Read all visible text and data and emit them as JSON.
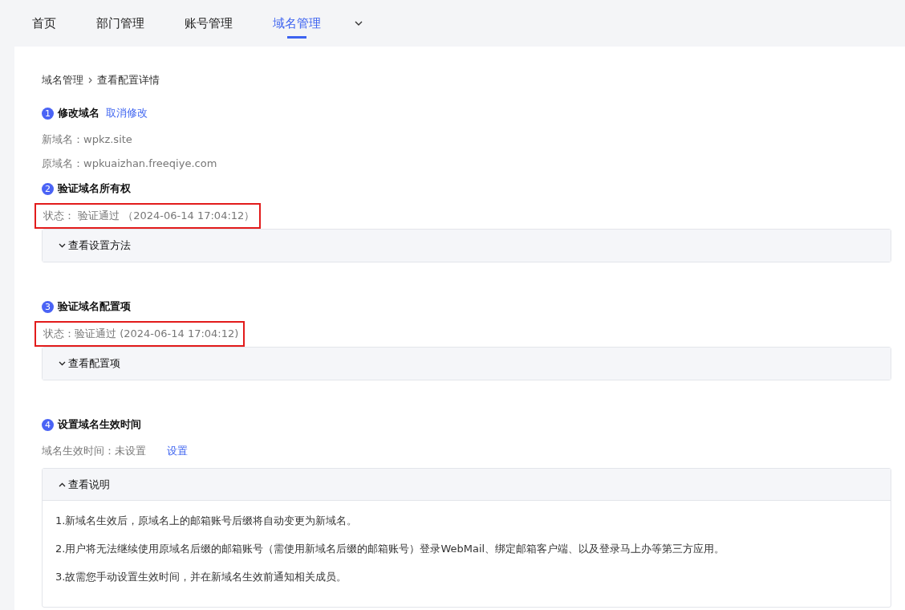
{
  "nav": {
    "tabs": [
      {
        "label": "首页",
        "selected": false
      },
      {
        "label": "部门管理",
        "selected": false
      },
      {
        "label": "账号管理",
        "selected": false
      },
      {
        "label": "域名管理",
        "selected": true
      }
    ]
  },
  "breadcrumb": [
    "域名管理",
    "查看配置详情"
  ],
  "steps": [
    {
      "number": "1",
      "title": "修改域名",
      "link": "取消修改",
      "lines": [
        "新域名：wpkz.site",
        "原域名：wpkuaizhan.freeqiye.com"
      ]
    },
    {
      "number": "2",
      "title": "验证域名所有权",
      "status": {
        "text": "状态： 验证通过 （2024-06-14 17:04:12）",
        "highlighted": true
      },
      "panel": {
        "label": "查看设置方法",
        "expanded": false
      }
    },
    {
      "number": "3",
      "title": "验证域名配置项",
      "status": {
        "text": "状态：验证通过 (2024-06-14 17:04:12)",
        "highlighted": true
      },
      "panel": {
        "label": "查看配置项",
        "expanded": false
      }
    },
    {
      "number": "4",
      "title": "设置域名生效时间",
      "setting": {
        "text": "域名生效时间：未设置",
        "link": "设置"
      },
      "panel": {
        "label": "查看说明",
        "expanded": true,
        "items": [
          "1.新域名生效后，原域名上的邮箱账号后缀将自动变更为新域名。",
          "2.用户将无法继续使用原域名后缀的邮箱账号（需使用新域名后缀的邮箱账号）登录WebMail、绑定邮箱客户端、以及登录马上办等第三方应用。",
          "3.故需您手动设置生效时间，并在新域名生效前通知相关成员。"
        ]
      }
    }
  ]
}
